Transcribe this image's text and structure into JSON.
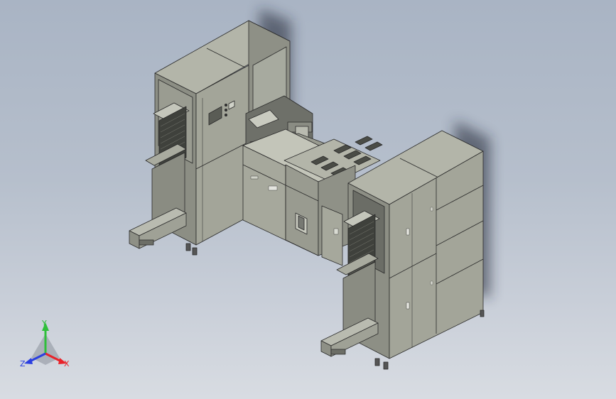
{
  "viewport": {
    "background_top": "#a9b4c4",
    "background_bottom": "#d8dce2",
    "model": {
      "panel_color": "#a0a296",
      "panel_dark": "#7d7f75",
      "panel_light": "#b8baae",
      "edge_color": "#2a2a2a"
    }
  },
  "triad": {
    "x_label": "X",
    "y_label": "Y",
    "z_label": "Z",
    "x_color": "#e8232a",
    "y_color": "#2fbf3a",
    "z_color": "#2a3fe0"
  }
}
